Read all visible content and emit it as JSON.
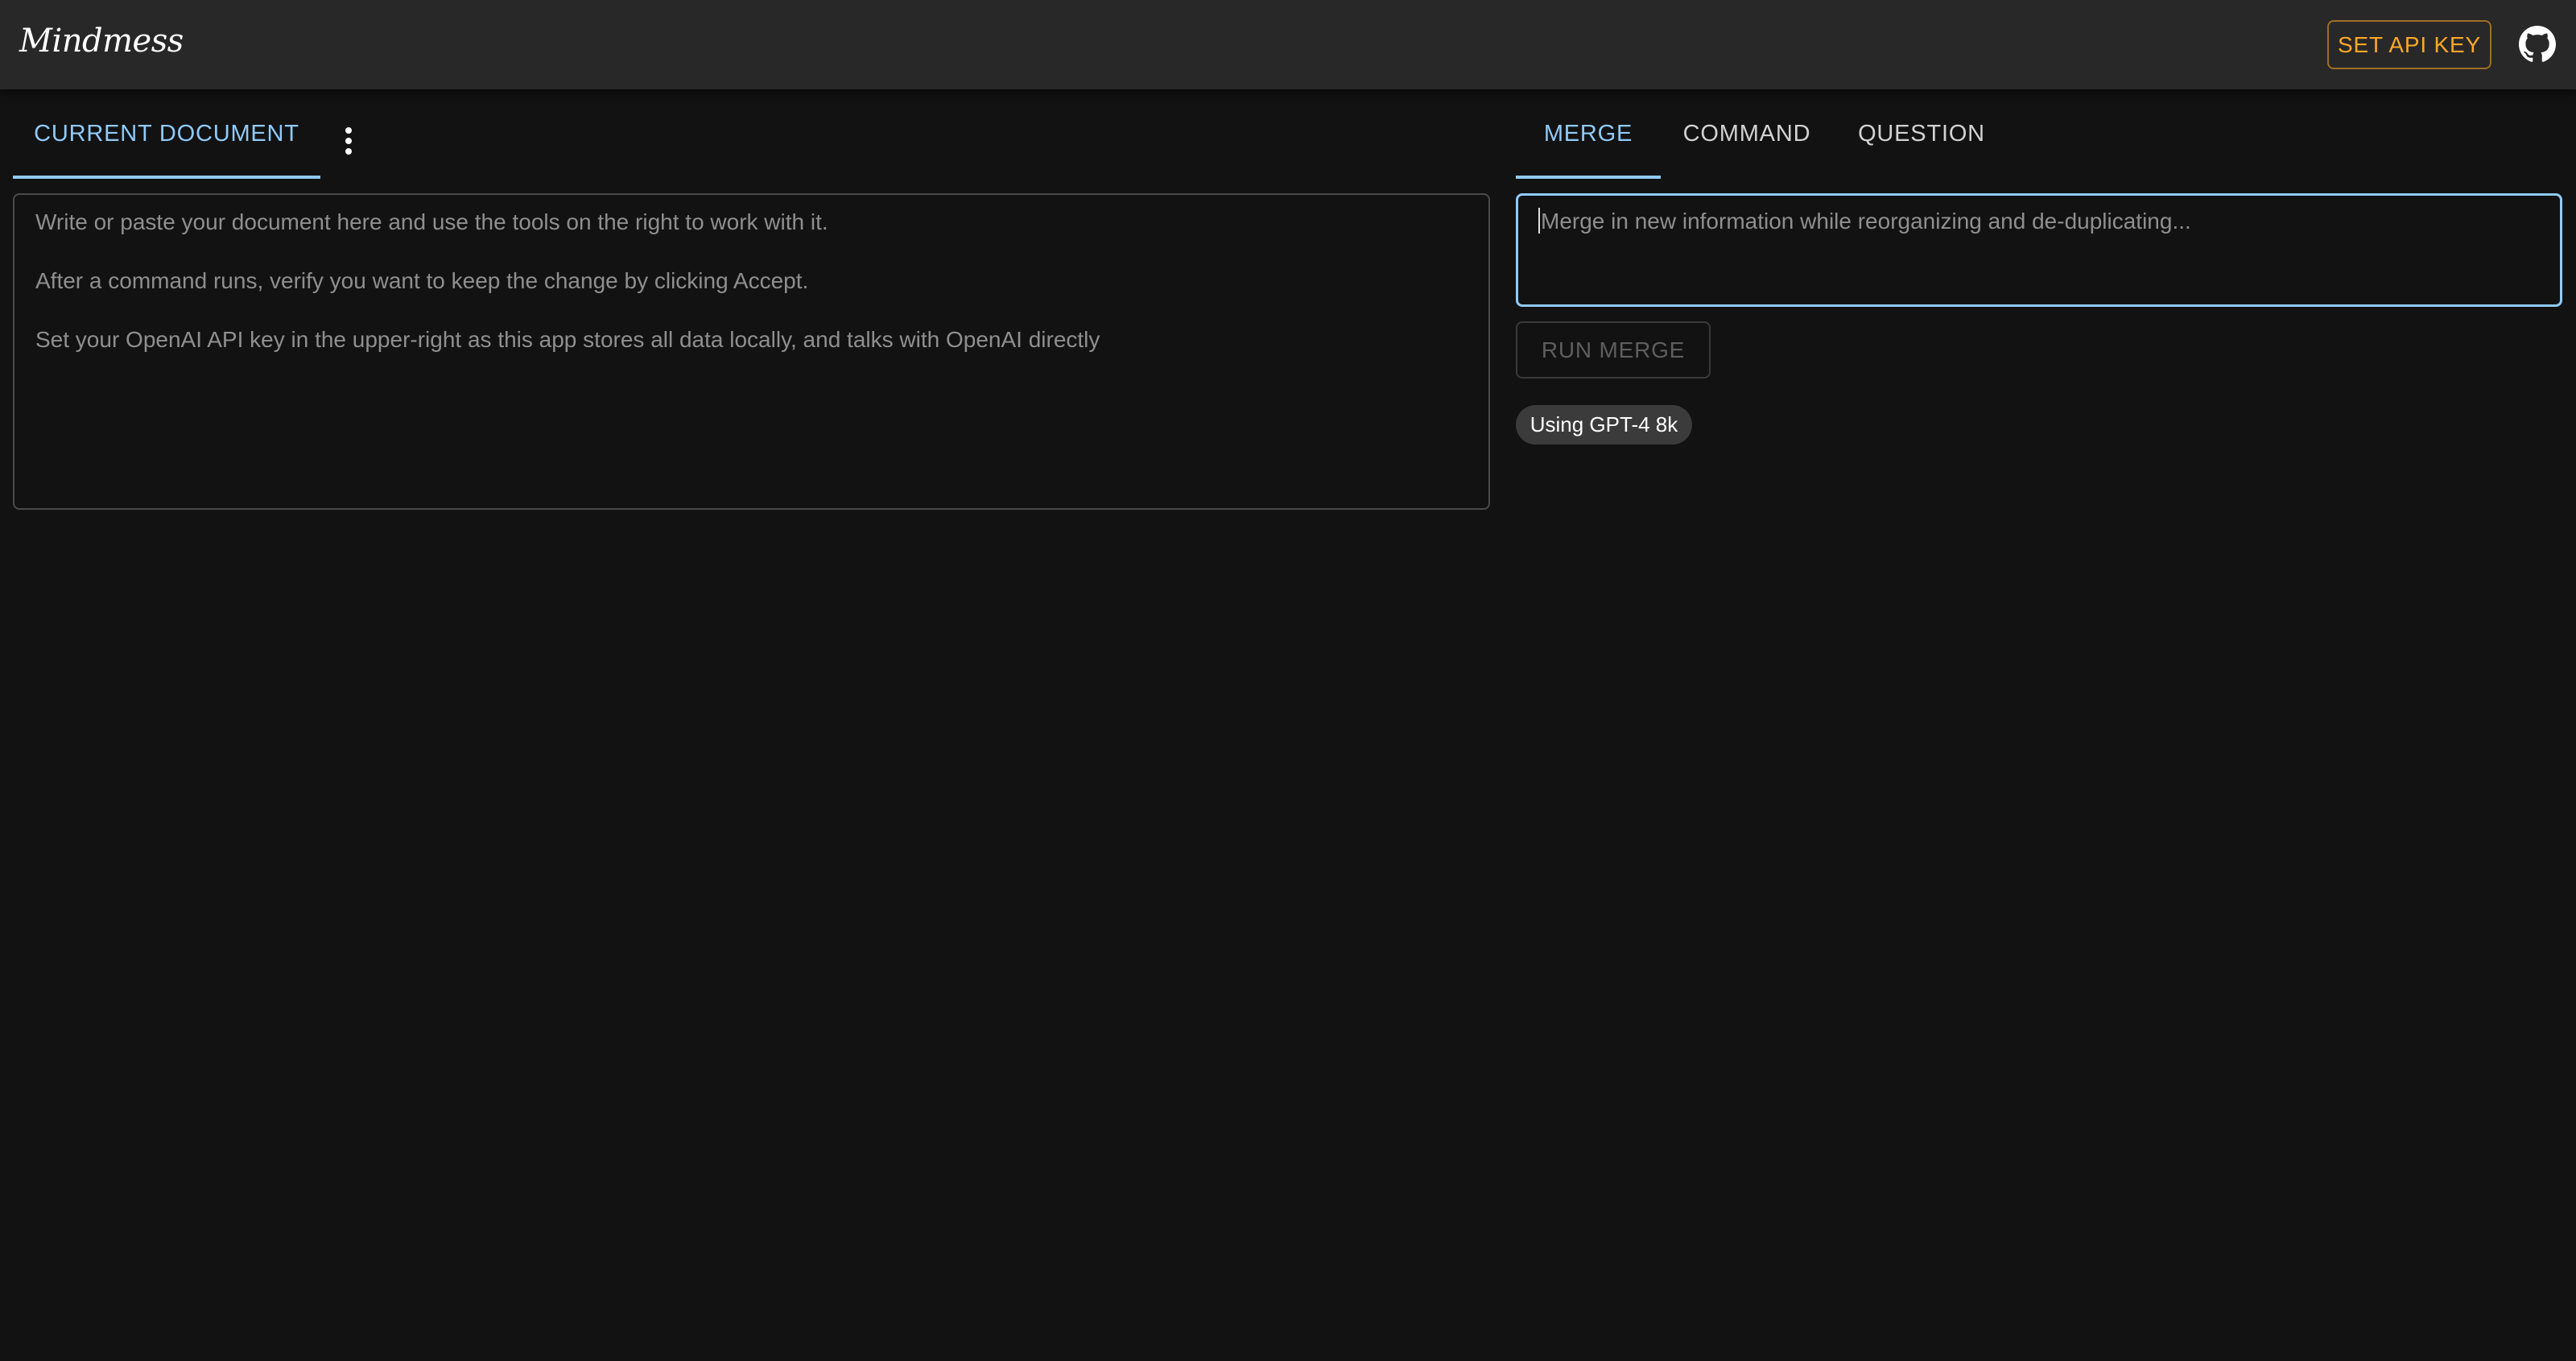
{
  "app": {
    "title": "Mindmess"
  },
  "header": {
    "api_key_label": "SET API KEY",
    "github_icon": "github-icon"
  },
  "document_panel": {
    "tab_label": "CURRENT DOCUMENT",
    "menu_icon": "more-vertical-icon",
    "lines": [
      "Write or paste your document here and use the tools on the right to work with it.",
      "After a command runs, verify you want to keep the change by clicking Accept.",
      "Set your OpenAI API key in the upper-right as this app stores all data locally, and talks with OpenAI directly"
    ]
  },
  "tools_panel": {
    "tabs": [
      {
        "label": "MERGE",
        "active": true
      },
      {
        "label": "COMMAND",
        "active": false
      },
      {
        "label": "QUESTION",
        "active": false
      }
    ],
    "merge_placeholder": "Merge in new information while reorganizing and de-duplicating...",
    "merge_value": "",
    "run_label": "RUN MERGE",
    "model_chip": "Using GPT-4 8k"
  },
  "colors": {
    "accent": "#90caf9",
    "warning": "#ffa726",
    "background": "#121212",
    "appbar": "#282828"
  }
}
